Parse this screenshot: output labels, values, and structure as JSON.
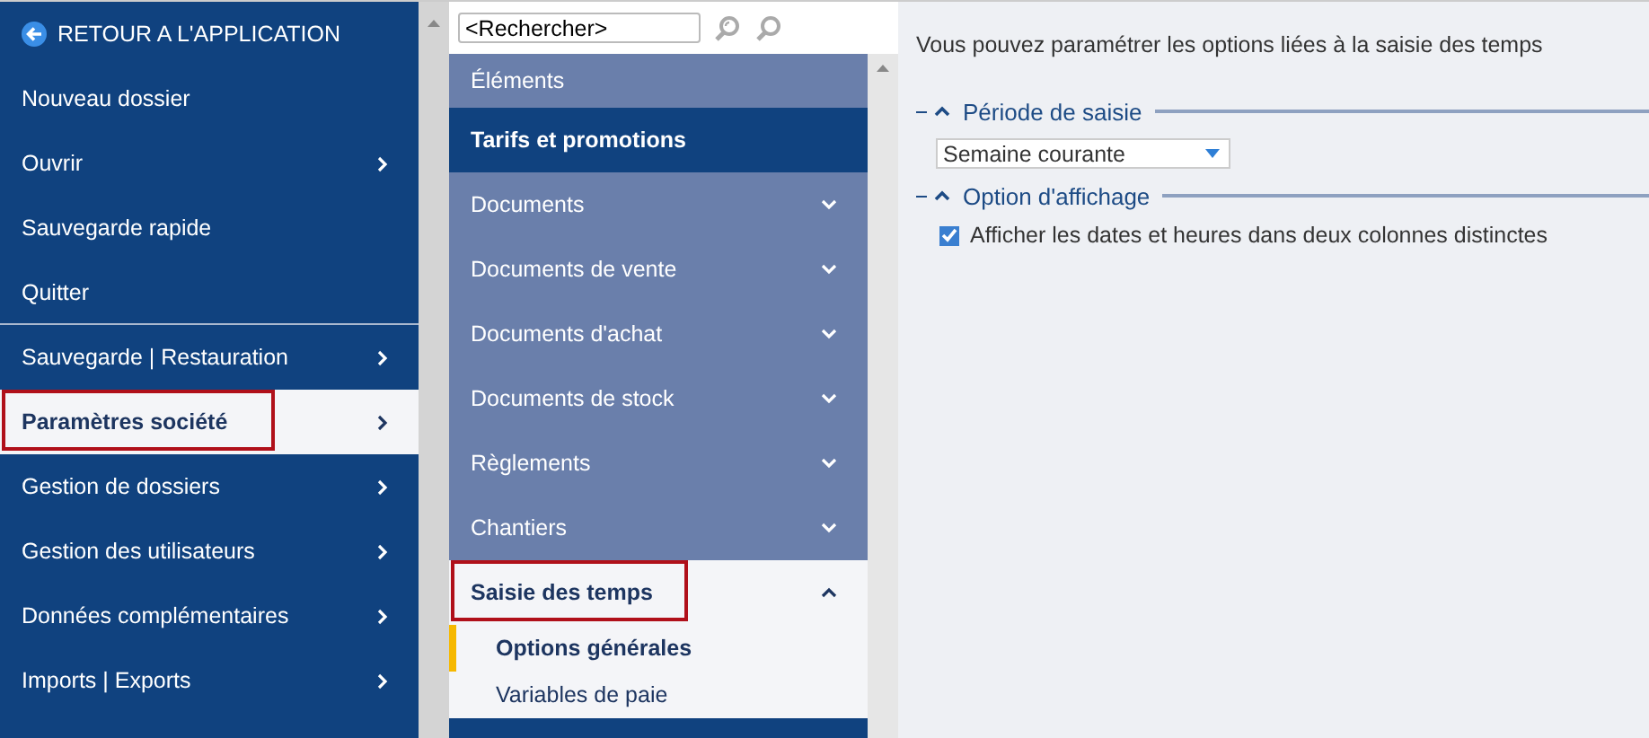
{
  "left_menu": {
    "back": "RETOUR A L'APPLICATION",
    "items": [
      {
        "label": "Nouveau dossier",
        "submenu": false,
        "selected": false,
        "highlighted": false,
        "divider_after": false
      },
      {
        "label": "Ouvrir",
        "submenu": true,
        "selected": false,
        "highlighted": false,
        "divider_after": false
      },
      {
        "label": "Sauvegarde rapide",
        "submenu": false,
        "selected": false,
        "highlighted": false,
        "divider_after": false
      },
      {
        "label": "Quitter",
        "submenu": false,
        "selected": false,
        "highlighted": false,
        "divider_after": true
      },
      {
        "label": "Sauvegarde | Restauration",
        "submenu": true,
        "selected": false,
        "highlighted": false,
        "divider_after": false
      },
      {
        "label": "Paramètres société",
        "submenu": true,
        "selected": true,
        "highlighted": true,
        "divider_after": false
      },
      {
        "label": "Gestion de dossiers",
        "submenu": true,
        "selected": false,
        "highlighted": false,
        "divider_after": false
      },
      {
        "label": "Gestion des utilisateurs",
        "submenu": true,
        "selected": false,
        "highlighted": false,
        "divider_after": false
      },
      {
        "label": "Données complémentaires",
        "submenu": true,
        "selected": false,
        "highlighted": false,
        "divider_after": false
      },
      {
        "label": "Imports | Exports",
        "submenu": true,
        "selected": false,
        "highlighted": false,
        "divider_after": false
      }
    ]
  },
  "search": {
    "value": "<Rechercher>"
  },
  "sections": [
    {
      "label": "Éléments",
      "kind": "plain",
      "selected": false,
      "highlighted": false
    },
    {
      "label": "Tarifs et promotions",
      "kind": "plain",
      "selected": true,
      "highlighted": false
    },
    {
      "label": "Documents",
      "kind": "group",
      "expanded": false,
      "selected": false,
      "highlighted": false
    },
    {
      "label": "Documents de vente",
      "kind": "group",
      "expanded": false,
      "selected": false,
      "highlighted": false
    },
    {
      "label": "Documents d'achat",
      "kind": "group",
      "expanded": false,
      "selected": false,
      "highlighted": false
    },
    {
      "label": "Documents de stock",
      "kind": "group",
      "expanded": false,
      "selected": false,
      "highlighted": false
    },
    {
      "label": "Règlements",
      "kind": "group",
      "expanded": false,
      "selected": false,
      "highlighted": false
    },
    {
      "label": "Chantiers",
      "kind": "group",
      "expanded": false,
      "selected": false,
      "highlighted": false
    },
    {
      "label": "Saisie des temps",
      "kind": "group",
      "expanded": true,
      "selected": false,
      "highlighted": true,
      "children": [
        {
          "label": "Options générales",
          "selected": true
        },
        {
          "label": "Variables de paie",
          "selected": false
        }
      ]
    }
  ],
  "content": {
    "intro": "Vous pouvez paramétrer les options liées à la saisie des temps",
    "groups": [
      {
        "title": "Période de saisie",
        "expanded": true,
        "fields": [
          {
            "kind": "dropdown",
            "value": "Semaine courante"
          }
        ]
      },
      {
        "title": "Option d'affichage",
        "expanded": true,
        "fields": [
          {
            "kind": "checkbox",
            "label": "Afficher les dates et heures dans deux colonnes distinctes",
            "checked": true
          }
        ]
      }
    ]
  }
}
